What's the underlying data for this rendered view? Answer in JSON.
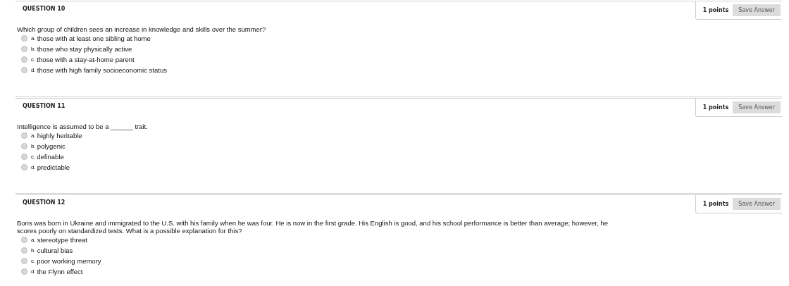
{
  "questions": [
    {
      "title": "QUESTION 10",
      "points": "1 points",
      "save_button": "Save Answer",
      "text": "Which group of children sees an increase in knowledge and skills over the summer?",
      "options": [
        {
          "letter": "a.",
          "text": "those with at least one sibling at home",
          "selected": false
        },
        {
          "letter": "b.",
          "text": "those who stay physically active",
          "selected": false
        },
        {
          "letter": "c.",
          "text": "those with a stay-at-home parent",
          "selected": false
        },
        {
          "letter": "d.",
          "text": "those with high family socioeconomic status",
          "selected": false
        }
      ]
    },
    {
      "title": "QUESTION 11",
      "points": "1 points",
      "save_button": "Save Answer",
      "text": "Intelligence is assumed to be a ______ trait.",
      "options": [
        {
          "letter": "a.",
          "text": "highly heritable",
          "selected": false
        },
        {
          "letter": "b.",
          "text": "polygenic",
          "selected": false
        },
        {
          "letter": "c.",
          "text": "definable",
          "selected": false
        },
        {
          "letter": "d.",
          "text": "predictable",
          "selected": false
        }
      ]
    },
    {
      "title": "QUESTION 12",
      "points": "1 points",
      "save_button": "Save Answer",
      "text": "Boris was born in Ukraine and immigrated to the U.S. with his family when he was four. He is now in the first grade. His English is good, and his school performance is better than average; however, he scores poorly on standardized tests. What is a possible explanation for this?",
      "options": [
        {
          "letter": "a.",
          "text": "stereotype threat",
          "selected": false
        },
        {
          "letter": "b.",
          "text": "cultural bias",
          "selected": false
        },
        {
          "letter": "c.",
          "text": "poor working memory",
          "selected": false
        },
        {
          "letter": "d.",
          "text": "the Flynn effect",
          "selected": false
        }
      ]
    }
  ]
}
